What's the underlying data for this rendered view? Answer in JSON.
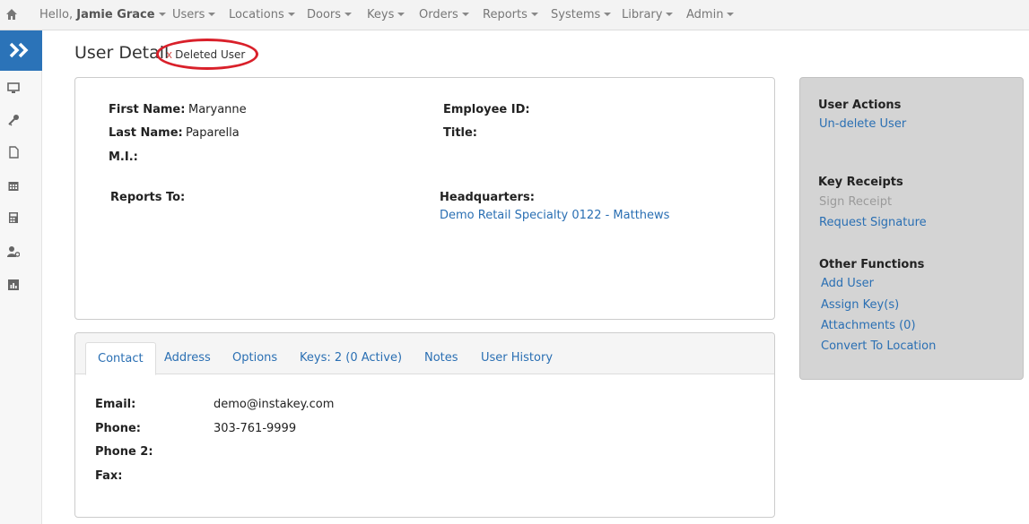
{
  "topnav": {
    "greeting_prefix": "Hello,",
    "user_name": "Jamie Grace",
    "items": [
      "Users",
      "Locations",
      "Doors",
      "Keys",
      "Orders",
      "Reports",
      "Systems",
      "Library",
      "Admin"
    ]
  },
  "sidebar": {
    "icons": [
      "monitor-icon",
      "key-icon",
      "document-icon",
      "calendar-icon",
      "calculator-icon",
      "user-settings-icon",
      "chart-icon"
    ]
  },
  "page": {
    "title": "User Detail",
    "badge_x": "x",
    "badge_text": "Deleted User"
  },
  "details": {
    "first_name_label": "First Name:",
    "first_name": "Maryanne",
    "last_name_label": "Last Name:",
    "last_name": "Paparella",
    "mi_label": "M.I.:",
    "employee_id_label": "Employee ID:",
    "title_label": "Title:",
    "reports_to_label": "Reports To:",
    "headquarters_label": "Headquarters:",
    "headquarters": "Demo Retail Specialty 0122 - Matthews"
  },
  "tabs": [
    "Contact",
    "Address",
    "Options",
    "Keys: 2 (0 Active)",
    "Notes",
    "User History"
  ],
  "contact": {
    "email_label": "Email:",
    "email": "demo@instakey.com",
    "phone_label": "Phone:",
    "phone": "303-761-9999",
    "phone2_label": "Phone 2:",
    "fax_label": "Fax:"
  },
  "actions": {
    "user_actions_heading": "User Actions",
    "undelete": "Un-delete User",
    "key_receipts_heading": "Key Receipts",
    "sign_receipt": "Sign Receipt",
    "request_signature": "Request Signature",
    "other_heading": "Other Functions",
    "add_user": "Add User",
    "assign_keys": "Assign Key(s)",
    "attachments": "Attachments (0)",
    "convert": "Convert To Location"
  },
  "colors": {
    "accent": "#2b73b8",
    "link": "#2a6fb3",
    "highlight": "#d9202a"
  }
}
